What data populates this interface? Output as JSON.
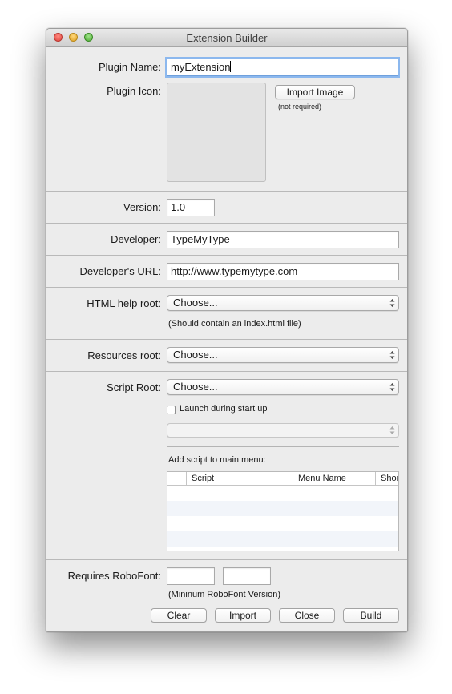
{
  "window": {
    "title": "Extension Builder"
  },
  "plugin_name": {
    "label": "Plugin Name:",
    "value": "myExtension"
  },
  "plugin_icon": {
    "label": "Plugin Icon:",
    "import_button": "Import Image",
    "note": "(not required)"
  },
  "version": {
    "label": "Version:",
    "value": "1.0"
  },
  "developer": {
    "label": "Developer:",
    "value": "TypeMyType"
  },
  "developer_url": {
    "label": "Developer's URL:",
    "value": "http://www.typemytype.com"
  },
  "html_help_root": {
    "label": "HTML help root:",
    "selected": "Choose...",
    "note": "(Should contain an index.html file)"
  },
  "resources_root": {
    "label": "Resources root:",
    "selected": "Choose..."
  },
  "script_root": {
    "label": "Script Root:",
    "selected": "Choose...",
    "launch_checkbox_label": "Launch during start up",
    "launch_checked": false,
    "launch_script_selected": ""
  },
  "main_menu": {
    "label": "Add script to main menu:",
    "columns": [
      "",
      "Script",
      "Menu Name",
      "Shor"
    ],
    "rows": []
  },
  "requires_robofont": {
    "label": "Requires RoboFont:",
    "min_value": "",
    "max_value": "",
    "note": "(Mininum RoboFont Version)"
  },
  "buttons": {
    "clear": "Clear",
    "import": "Import",
    "close": "Close",
    "build": "Build"
  }
}
